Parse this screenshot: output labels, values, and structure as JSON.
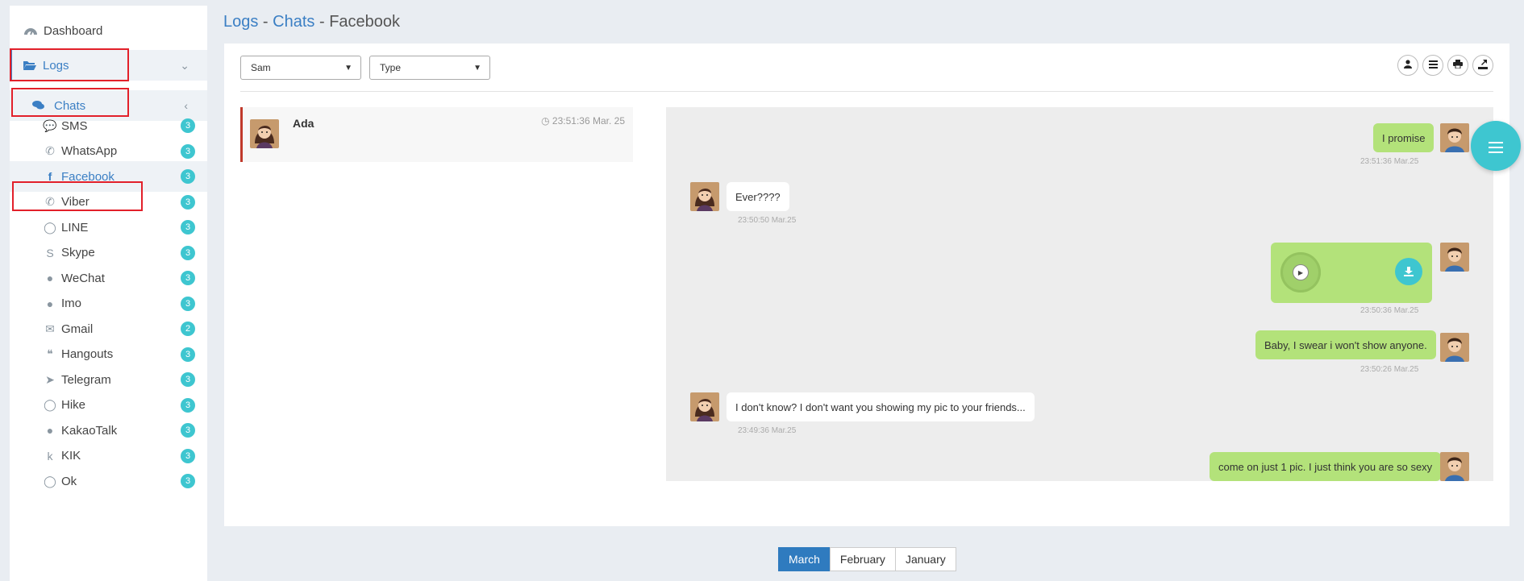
{
  "header": {
    "crumb_logs": "Logs",
    "sep1": " - ",
    "crumb_chats": "Chats",
    "sep2": " - ",
    "current": "Facebook"
  },
  "sidebar": {
    "dashboard": "Dashboard",
    "logs": "Logs",
    "chats": "Chats",
    "apps": [
      {
        "label": "SMS",
        "count": "3",
        "icon": "sms-icon"
      },
      {
        "label": "WhatsApp",
        "count": "3",
        "icon": "whatsapp-icon"
      },
      {
        "label": "Facebook",
        "count": "3",
        "icon": "facebook-icon"
      },
      {
        "label": "Viber",
        "count": "3",
        "icon": "phone-icon"
      },
      {
        "label": "LINE",
        "count": "3",
        "icon": "line-icon"
      },
      {
        "label": "Skype",
        "count": "3",
        "icon": "skype-icon"
      },
      {
        "label": "WeChat",
        "count": "3",
        "icon": "wechat-icon"
      },
      {
        "label": "Imo",
        "count": "3",
        "icon": "imo-icon"
      },
      {
        "label": "Gmail",
        "count": "2",
        "icon": "envelope-icon"
      },
      {
        "label": "Hangouts",
        "count": "3",
        "icon": "hangouts-icon"
      },
      {
        "label": "Telegram",
        "count": "3",
        "icon": "paper-plane-icon"
      },
      {
        "label": "Hike",
        "count": "3",
        "icon": "hike-icon"
      },
      {
        "label": "KakaoTalk",
        "count": "3",
        "icon": "kakaotalk-icon"
      },
      {
        "label": "KIK",
        "count": "3",
        "icon": "kik-icon"
      },
      {
        "label": "Ok",
        "count": "3",
        "icon": "ok-icon"
      }
    ]
  },
  "filters": {
    "contact": "Sam",
    "type": "Type"
  },
  "conversation": {
    "name": "Ada",
    "time": "23:51:36 Mar. 25"
  },
  "messages": [
    {
      "dir": "out",
      "text": "I promise",
      "time": "23:51:36 Mar.25"
    },
    {
      "dir": "in",
      "text": "Ever????",
      "time": "23:50:50 Mar.25"
    },
    {
      "dir": "out",
      "text": "",
      "time": "23:50:36 Mar.25",
      "kind": "audio"
    },
    {
      "dir": "out",
      "text": "Baby, I swear i won't show anyone.",
      "time": "23:50:26 Mar.25"
    },
    {
      "dir": "in",
      "text": "I don't know? I don't want you showing my pic to your friends...",
      "time": "23:49:36 Mar.25"
    },
    {
      "dir": "out",
      "text": "come on just 1 pic. I just think you are so sexy",
      "time": ""
    }
  ],
  "months": [
    "March",
    "February",
    "January"
  ],
  "colors": {
    "accent": "#3b7fc4",
    "badge": "#3ec6d0",
    "out_bubble": "#b3e27a",
    "highlight": "#e2202a"
  }
}
